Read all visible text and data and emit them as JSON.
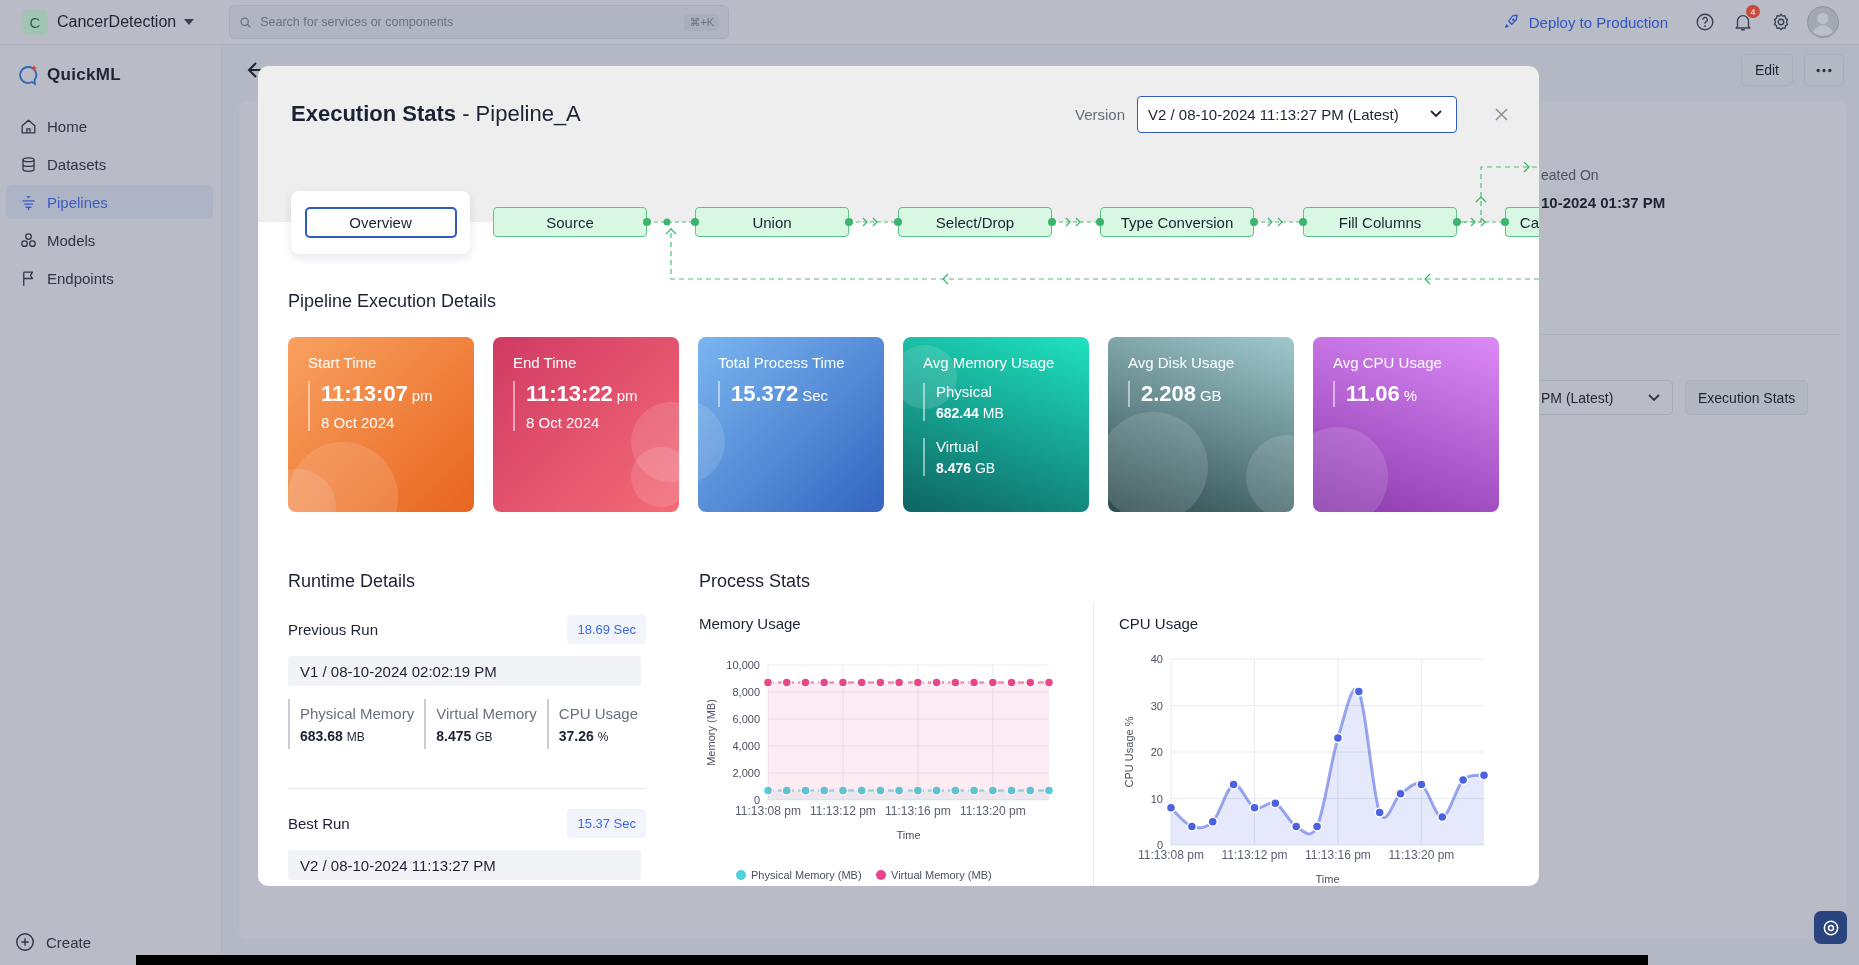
{
  "topbar": {
    "project_initial": "C",
    "project": "CancerDetection",
    "search": {
      "placeholder": "Search for services or components",
      "shortcut": "⌘+K"
    },
    "deploy": "Deploy to Production",
    "notifications": "4"
  },
  "sidebar": {
    "brand": "QuickML",
    "items": [
      {
        "label": "Home",
        "selected": false
      },
      {
        "label": "Datasets",
        "selected": false
      },
      {
        "label": "Pipelines",
        "selected": true
      },
      {
        "label": "Models",
        "selected": false
      },
      {
        "label": "Endpoints",
        "selected": false
      }
    ],
    "create": "Create"
  },
  "page": {
    "edit": "Edit",
    "created_label": "eated On",
    "created_value": "10-2024 01:37 PM",
    "version_select": "PM (Latest)",
    "stats_button": "Execution Stats"
  },
  "modal": {
    "title": "**Execution Stats** - Pipeline_A",
    "version_label": "Version",
    "version_value": "V2 / 08-10-2024 11:13:27 PM (Latest)",
    "tab": {
      "label": "Overview",
      "selected": true
    },
    "nodes": [
      {
        "label": "Source"
      },
      {
        "label": "Union"
      },
      {
        "label": "Select/Drop"
      },
      {
        "label": "Type Conversion"
      },
      {
        "label": "Fill Columns"
      },
      {
        "label": "Ca"
      }
    ],
    "details_title": "Pipeline Execution Details",
    "cards": [
      {
        "kind": "time",
        "label": "Start Time",
        "value": "11:13:07",
        "unit": "pm",
        "date": "8 Oct 2024"
      },
      {
        "kind": "time",
        "label": "End Time",
        "value": "11:13:22",
        "unit": "pm",
        "date": "8 Oct 2024"
      },
      {
        "kind": "value",
        "label": "Total Process Time",
        "value": "15.372",
        "unit": "Sec"
      },
      {
        "kind": "memory",
        "label": "Avg Memory Usage",
        "entries": [
          {
            "label": "Physical",
            "value": "682.44",
            "unit": "MB"
          },
          {
            "label": "Virtual",
            "value": "8.476",
            "unit": "GB"
          }
        ]
      },
      {
        "kind": "value",
        "label": "Avg Disk Usage",
        "value": "2.208",
        "unit": "GB"
      },
      {
        "kind": "value",
        "label": "Avg CPU Usage",
        "value": "11.06",
        "unit": "%"
      }
    ],
    "runtime": {
      "title": "Runtime Details",
      "runs": [
        {
          "label": "Previous Run",
          "duration": "18.69 Sec",
          "version": "V1 / 08-10-2024 02:02:19 PM",
          "stats": [
            {
              "label": "Physical Memory",
              "value": "683.68",
              "unit": "MB"
            },
            {
              "label": "Virtual Memory",
              "value": "8.475",
              "unit": "GB"
            },
            {
              "label": "CPU Usage",
              "value": "37.26",
              "unit": "%"
            }
          ]
        },
        {
          "label": "Best Run",
          "duration": "15.37 Sec",
          "version": "V2 / 08-10-2024 11:13:27 PM"
        }
      ]
    },
    "process": {
      "title": "Process Stats",
      "charts": [
        {
          "title": "Memory Usage",
          "chart_data": {
            "type": "area",
            "grid": true,
            "legend": true,
            "xlabel": "Time",
            "ylabel": "Memory (MB)",
            "categories": [
              "11:13:08 pm",
              null,
              null,
              null,
              "11:13:12 pm",
              null,
              null,
              null,
              "11:13:16 pm",
              null,
              null,
              null,
              "11:13:20 pm",
              null,
              null,
              null
            ],
            "ylim": [
              0,
              10000
            ],
            "yticks": [
              {
                "value": 0,
                "label": "0"
              },
              {
                "value": 2000,
                "label": "2,000"
              },
              {
                "value": 4000,
                "label": "4,000"
              },
              {
                "value": 6000,
                "label": "6,000"
              },
              {
                "value": 8000,
                "label": "8,000"
              },
              {
                "value": 10000,
                "label": "10,000"
              }
            ],
            "series": [
              {
                "name": "Physical Memory (MB)",
                "color": "#4fd1d9",
                "values": [
                  700,
                  700,
                  700,
                  700,
                  700,
                  700,
                  700,
                  700,
                  700,
                  700,
                  700,
                  700,
                  700,
                  700,
                  700,
                  700
                ]
              },
              {
                "name": "Virtual Memory (MB)",
                "color": "#e8468a",
                "values": [
                  8700,
                  8700,
                  8700,
                  8700,
                  8700,
                  8700,
                  8700,
                  8700,
                  8700,
                  8700,
                  8700,
                  8700,
                  8700,
                  8700,
                  8700,
                  8700
                ]
              }
            ]
          }
        },
        {
          "title": "CPU Usage",
          "chart_data": {
            "type": "area",
            "grid": true,
            "xlabel": "Time",
            "ylabel": "CPU Usage %",
            "categories": [
              "11:13:08 pm",
              null,
              null,
              null,
              "11:13:12 pm",
              null,
              null,
              null,
              "11:13:16 pm",
              null,
              null,
              null,
              "11:13:20 pm",
              null,
              null,
              null
            ],
            "ylim": [
              0,
              40
            ],
            "yticks": [
              0,
              10,
              20,
              30,
              40
            ],
            "values": [
              8,
              4,
              5,
              13,
              8,
              9,
              4,
              4,
              23,
              33,
              7,
              11,
              13,
              6,
              14,
              15
            ]
          }
        }
      ]
    }
  }
}
